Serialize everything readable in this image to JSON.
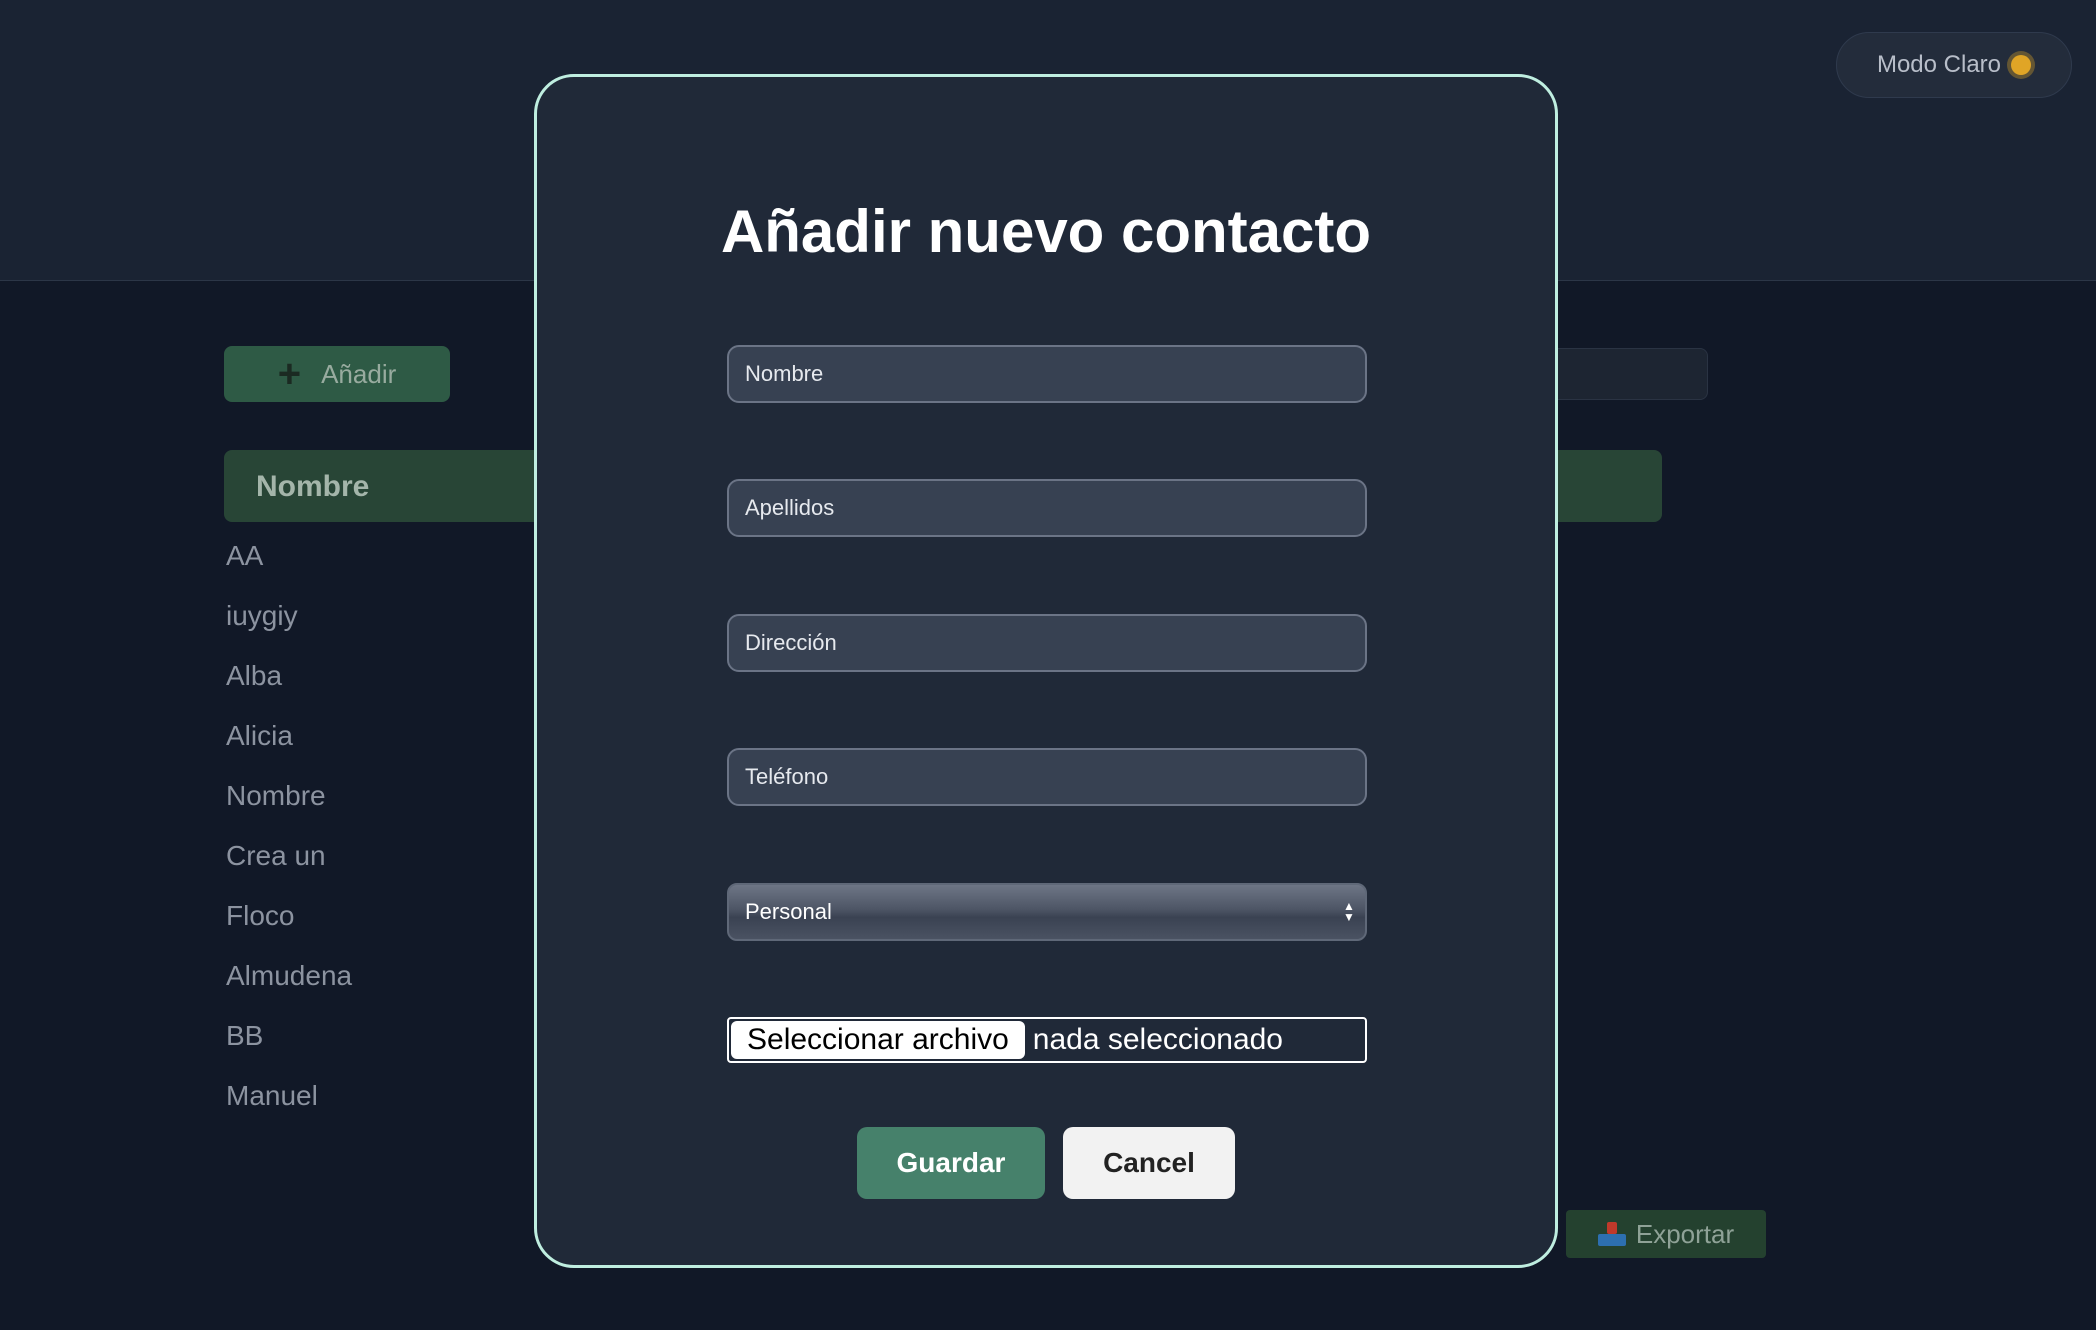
{
  "header": {
    "theme_toggle_label": "Modo Claro",
    "theme_toggle_icon": "sun-icon"
  },
  "toolbar": {
    "add_label": "Añadir",
    "add_icon": "plus-icon"
  },
  "table": {
    "header_name": "Nombre",
    "rows": [
      "AA",
      "iuygiy",
      "Alba",
      "Alicia",
      "Nombre",
      "Crea un",
      "Floco",
      "Almudena",
      "BB",
      "Manuel"
    ]
  },
  "footer": {
    "export_label": "Exportar",
    "export_icon": "inbox-icon"
  },
  "modal": {
    "title": "Añadir nuevo contacto",
    "fields": {
      "nombre_placeholder": "Nombre",
      "apellidos_placeholder": "Apellidos",
      "direccion_placeholder": "Dirección",
      "telefono_placeholder": "Teléfono"
    },
    "category_selected": "Personal",
    "file": {
      "button_label": "Seleccionar archivo",
      "status": "nada seleccionado"
    },
    "save_label": "Guardar",
    "cancel_label": "Cancel"
  },
  "colors": {
    "accent_green": "#46816b",
    "modal_border": "#bfeee0",
    "background": "#111827"
  }
}
